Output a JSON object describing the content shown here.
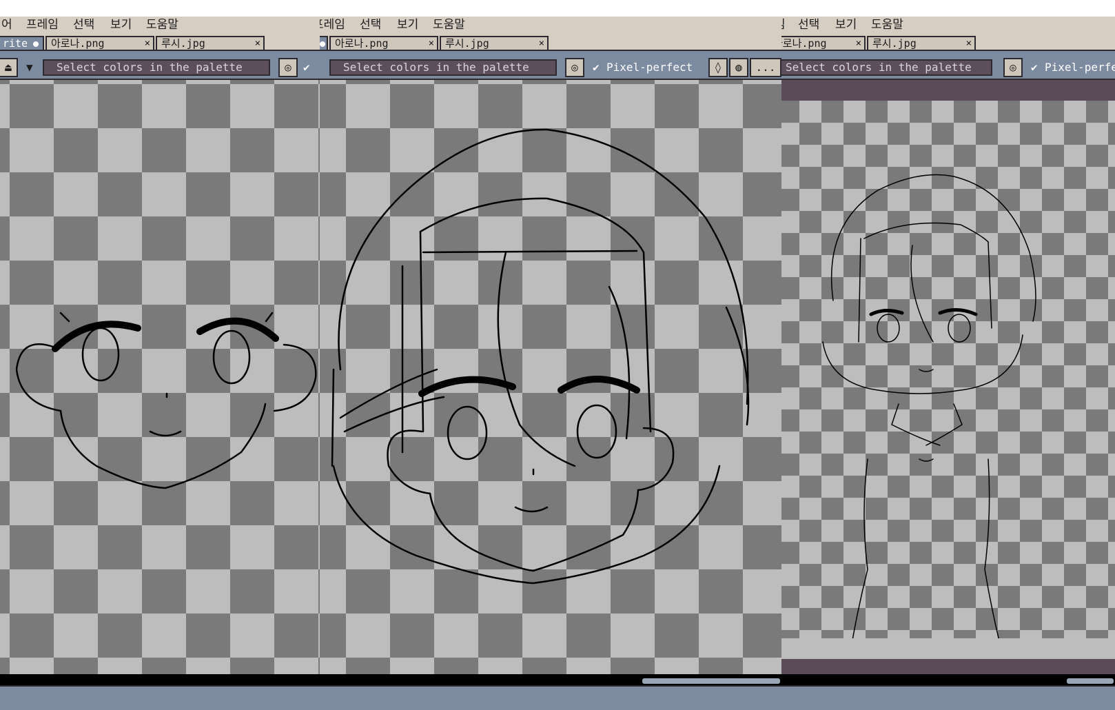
{
  "menu": {
    "panel1": [
      "어",
      "프레임",
      "선택",
      "보기",
      "도움말"
    ],
    "panel2": [
      "프레임",
      "선택",
      "보기",
      "도움말"
    ],
    "panel3": [
      "임",
      "선택",
      "보기",
      "도움말"
    ]
  },
  "tabs": {
    "panel1": [
      {
        "label": "rite",
        "active": true
      },
      {
        "label": "아로나.png",
        "active": false
      },
      {
        "label": "루시.jpg",
        "active": false
      }
    ],
    "panel2": [
      {
        "label": "아로나.png",
        "active": false
      },
      {
        "label": "루시.jpg",
        "active": false
      }
    ],
    "panel3": [
      {
        "label": "아로나.png",
        "active": false
      },
      {
        "label": "루시.jpg",
        "active": false
      }
    ],
    "close_glyph": "×"
  },
  "toolbar": {
    "hint": "Select colors in the palette",
    "pixel_perfect_label": "Pixel-perfect",
    "more_label": "...",
    "check_glyph": "✔",
    "dropdown_glyph": "▼",
    "zoom_glyph": "◎",
    "stamp_glyph": "⏏"
  },
  "colors": {
    "menubar": "#d6cec3",
    "toolbar": "#7d8ba0",
    "hint_bg": "#5d4e5b",
    "checker_light": "#bdbdbd",
    "checker_dark": "#7a7a7a",
    "frame_band": "#5b4b58"
  }
}
